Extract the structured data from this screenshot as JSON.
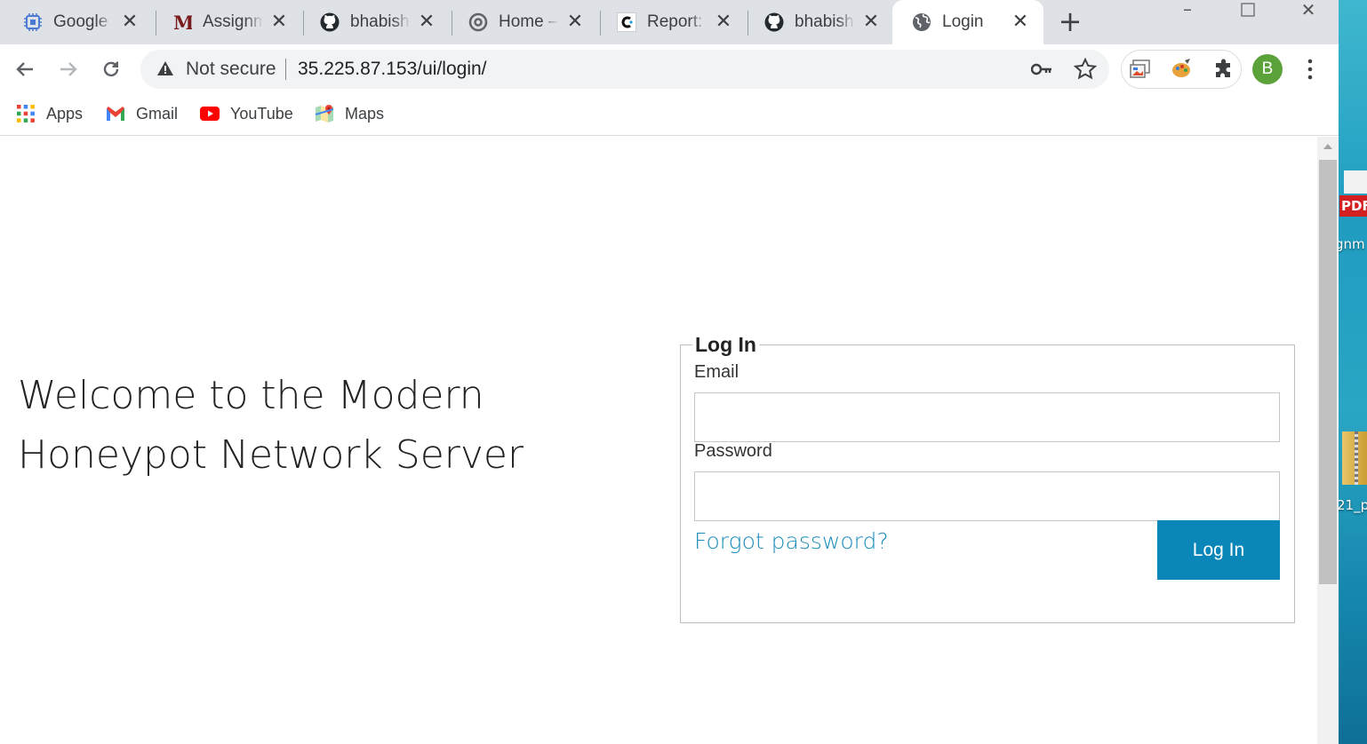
{
  "desktop": {
    "pdf_badge": "PDF",
    "label_1": "gnm",
    "label_2": "21_p"
  },
  "browser": {
    "tabs": [
      {
        "title": "Google C",
        "icon": "google-cloud-icon"
      },
      {
        "title": "Assignme",
        "icon": "mail-m-icon"
      },
      {
        "title": "bhabishs",
        "icon": "github-icon"
      },
      {
        "title": "Home – I",
        "icon": "gear-chrome-icon"
      },
      {
        "title": "Report: U",
        "icon": "report-c-icon"
      },
      {
        "title": "bhabishs",
        "icon": "github-icon"
      },
      {
        "title": "Login",
        "icon": "globe-icon"
      }
    ],
    "omnibox": {
      "security_text": "Not secure",
      "url": "35.225.87.153/ui/login/"
    },
    "profile_initial": "B",
    "bookmarks": [
      {
        "label": "Apps",
        "icon": "apps-grid-icon"
      },
      {
        "label": "Gmail",
        "icon": "gmail-icon"
      },
      {
        "label": "YouTube",
        "icon": "youtube-icon"
      },
      {
        "label": "Maps",
        "icon": "maps-icon"
      }
    ]
  },
  "page": {
    "welcome_line_1": "Welcome to the Modern",
    "welcome_line_2": "Honeypot Network Server",
    "form": {
      "legend": "Log In",
      "email_label": "Email",
      "email_value": "",
      "password_label": "Password",
      "password_value": "",
      "forgot_link": "Forgot password?",
      "submit_label": "Log In"
    }
  },
  "colors": {
    "primary_button": "#0a87b8",
    "link": "#1d8dbb",
    "tabstrip": "#dee1e6",
    "profile_avatar": "#5ba23a"
  }
}
